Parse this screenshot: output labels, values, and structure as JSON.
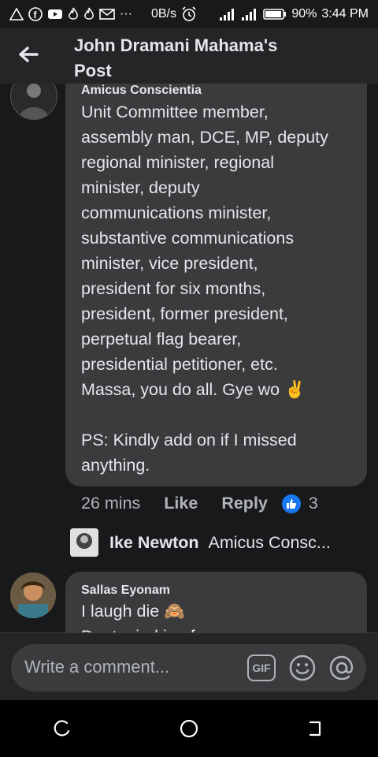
{
  "status_bar": {
    "network_speed": "0B/s",
    "battery": "90%",
    "time": "3:44 PM",
    "left_icons": [
      "warning-icon",
      "facebook-icon",
      "youtube-icon",
      "fire-icon",
      "fire-icon",
      "gmail-icon",
      "more-icon"
    ],
    "more": "···"
  },
  "header": {
    "title_line1": "John Dramani Mahama's",
    "title_line2": "Post"
  },
  "comments": [
    {
      "author": "Amicus Conscientia",
      "lines": [
        "Unit Committee member,",
        "assembly man, DCE, MP, deputy",
        "regional minister, regional",
        "minister, deputy",
        "communications minister,",
        "substantive communications",
        "minister, vice president,",
        "president for six months,",
        "president, former president,",
        "perpetual flag bearer,",
        "presidential petitioner, etc.",
        "Massa, you do all. Gye wo ✌️",
        "",
        "PS: Kindly add on if I missed",
        "anything."
      ],
      "time": "26 mins",
      "like_label": "Like",
      "reply_label": "Reply",
      "reaction_count": "3"
    },
    {
      "author": "Sallas Eyonam",
      "lines": [
        "I laugh die 🙈",
        "Dont mind in of"
      ]
    }
  ],
  "reply_preview": {
    "author": "Ike Newton",
    "text": "Amicus Consc..."
  },
  "composer": {
    "placeholder": "Write a comment...",
    "gif_label": "GIF"
  },
  "colors": {
    "background": "#18191a",
    "surface": "#242526",
    "bubble": "#3a3b3c",
    "text": "#e4e6eb",
    "secondary_text": "#b0b3b8",
    "like_blue": "#1877f2"
  }
}
